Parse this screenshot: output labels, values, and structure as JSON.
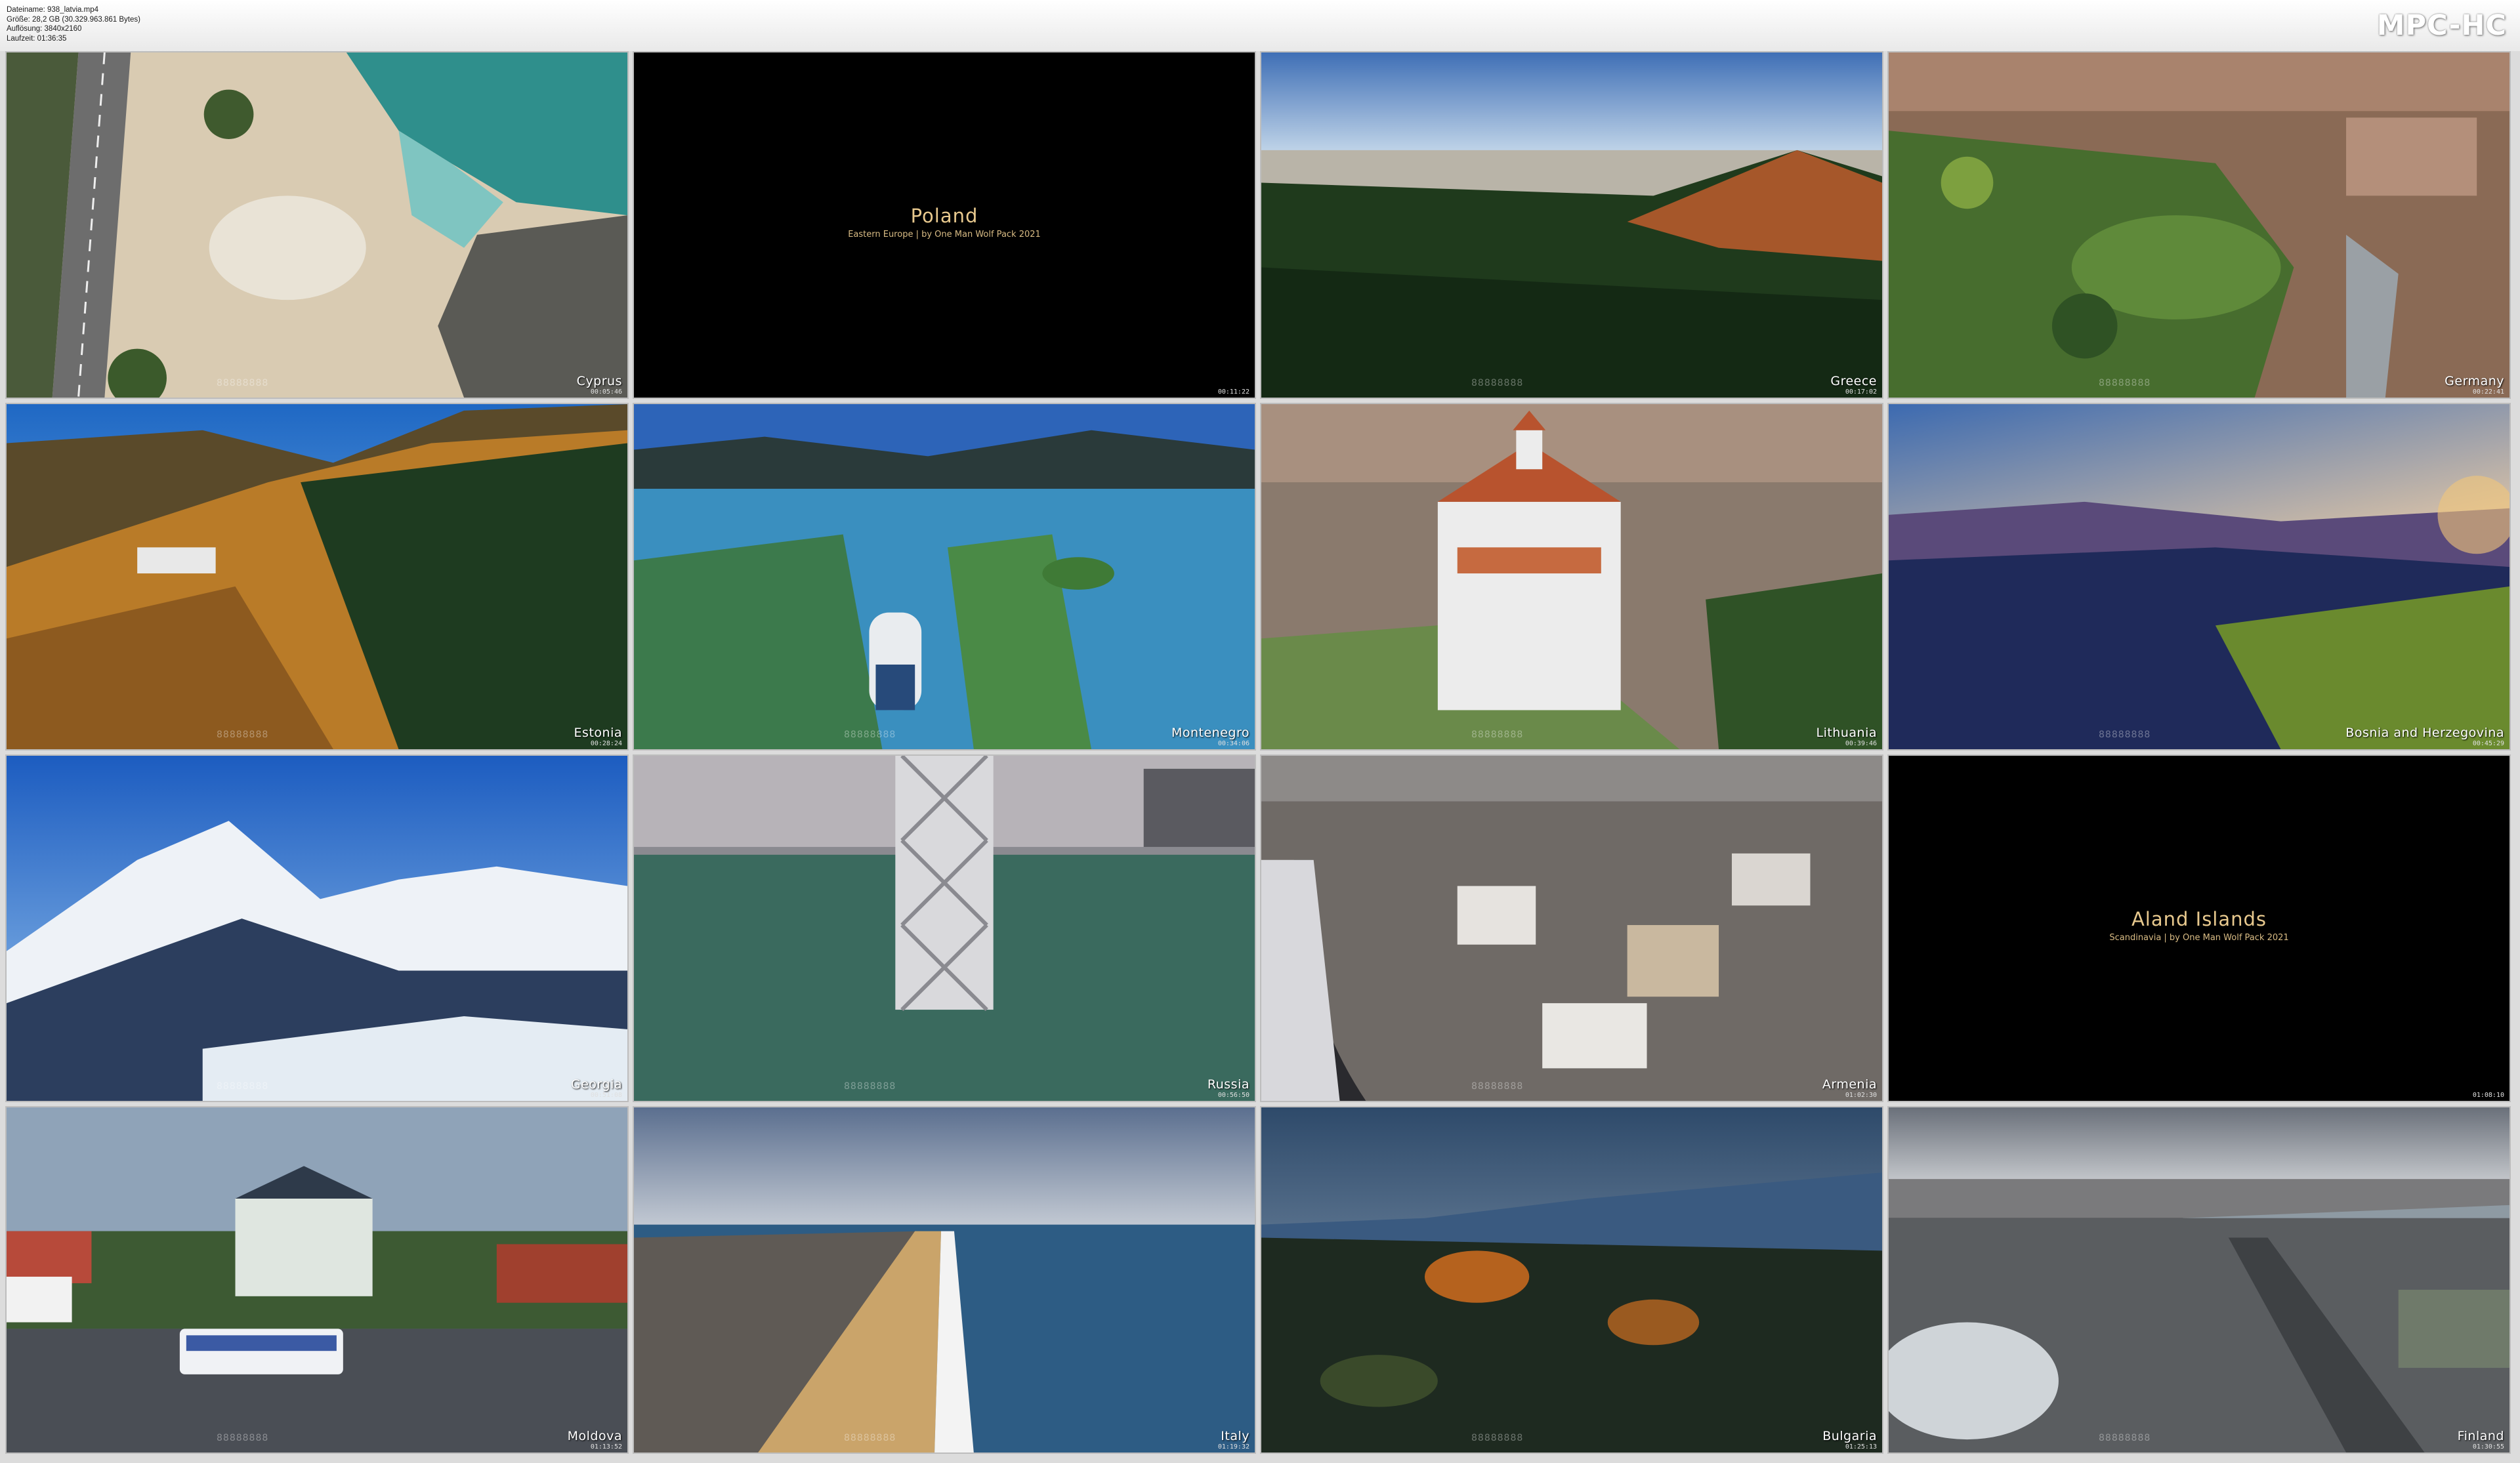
{
  "header": {
    "filename": "Dateiname: 938_latvia.mp4",
    "size": "Größe: 28,2 GB (30.329.963.861 Bytes)",
    "resolution": "Auflösung: 3840x2160",
    "duration": "Laufzeit: 01:36:35",
    "brand": "MPC-HC"
  },
  "tiles": [
    {
      "location": "Cyprus",
      "timestamp": "00:05:46",
      "watermark": "88888888"
    },
    {
      "title": "Poland",
      "subtitle": "Eastern Europe | by One Man Wolf Pack 2021",
      "timestamp": "00:11:22"
    },
    {
      "location": "Greece",
      "timestamp": "00:17:02",
      "watermark": "88888888"
    },
    {
      "location": "Germany",
      "timestamp": "00:22:41",
      "watermark": "88888888"
    },
    {
      "location": "Estonia",
      "timestamp": "00:28:24",
      "watermark": "88888888"
    },
    {
      "location": "Montenegro",
      "timestamp": "00:34:06",
      "watermark": "88888888"
    },
    {
      "location": "Lithuania",
      "timestamp": "00:39:46",
      "watermark": "88888888"
    },
    {
      "location": "Bosnia and Herzegovina",
      "timestamp": "00:45:29",
      "watermark": "88888888"
    },
    {
      "location": "Georgia",
      "timestamp": "00:51:08",
      "watermark": "88888888"
    },
    {
      "location": "Russia",
      "timestamp": "00:56:50",
      "watermark": "88888888"
    },
    {
      "location": "Armenia",
      "timestamp": "01:02:30",
      "watermark": "88888888"
    },
    {
      "title": "Aland Islands",
      "subtitle": "Scandinavia | by One Man Wolf Pack 2021",
      "timestamp": "01:08:10"
    },
    {
      "location": "Moldova",
      "timestamp": "01:13:52",
      "watermark": "88888888"
    },
    {
      "location": "Italy",
      "timestamp": "01:19:32",
      "watermark": "88888888"
    },
    {
      "location": "Bulgaria",
      "timestamp": "01:25:13",
      "watermark": "88888888"
    },
    {
      "location": "Finland",
      "timestamp": "01:30:55",
      "watermark": "88888888"
    }
  ]
}
